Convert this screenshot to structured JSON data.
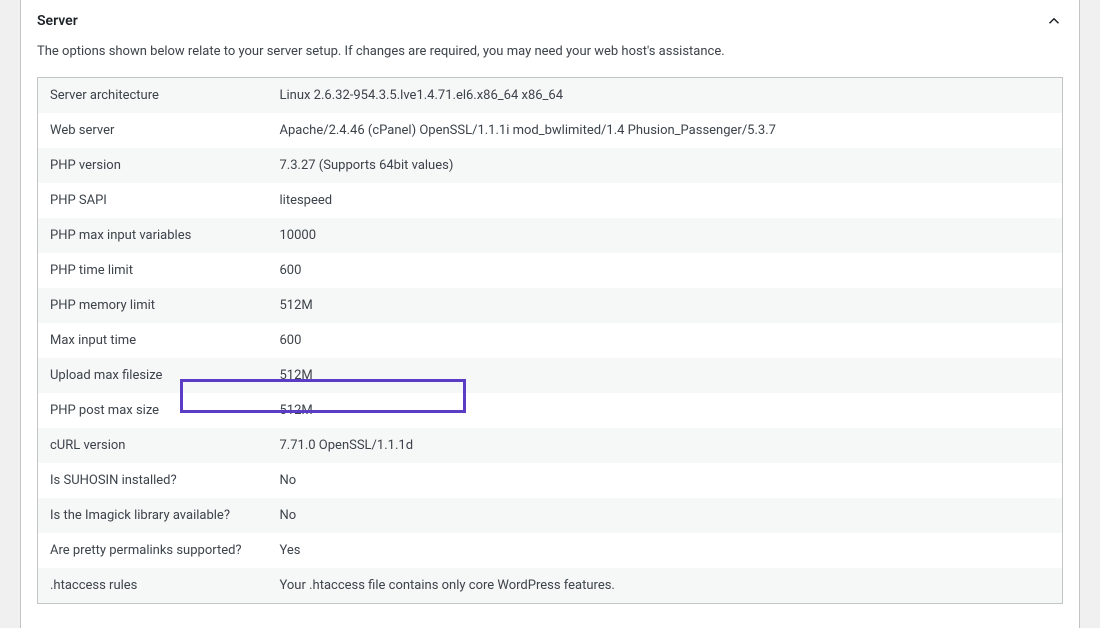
{
  "section": {
    "title": "Server",
    "description": "The options shown below relate to your server setup. If changes are required, you may need your web host's assistance."
  },
  "rows": [
    {
      "label": "Server architecture",
      "value": "Linux 2.6.32-954.3.5.lve1.4.71.el6.x86_64 x86_64"
    },
    {
      "label": "Web server",
      "value": "Apache/2.4.46 (cPanel) OpenSSL/1.1.1i mod_bwlimited/1.4 Phusion_Passenger/5.3.7"
    },
    {
      "label": "PHP version",
      "value": "7.3.27 (Supports 64bit values)"
    },
    {
      "label": "PHP SAPI",
      "value": "litespeed"
    },
    {
      "label": "PHP max input variables",
      "value": "10000"
    },
    {
      "label": "PHP time limit",
      "value": "600"
    },
    {
      "label": "PHP memory limit",
      "value": "512M"
    },
    {
      "label": "Max input time",
      "value": "600"
    },
    {
      "label": "Upload max filesize",
      "value": "512M"
    },
    {
      "label": "PHP post max size",
      "value": "512M"
    },
    {
      "label": "cURL version",
      "value": "7.71.0 OpenSSL/1.1.1d"
    },
    {
      "label": "Is SUHOSIN installed?",
      "value": "No"
    },
    {
      "label": "Is the Imagick library available?",
      "value": "No"
    },
    {
      "label": "Are pretty permalinks supported?",
      "value": "Yes"
    },
    {
      "label": ".htaccess rules",
      "value": "Your .htaccess file contains only core WordPress features."
    }
  ],
  "highlighted_index": 8
}
